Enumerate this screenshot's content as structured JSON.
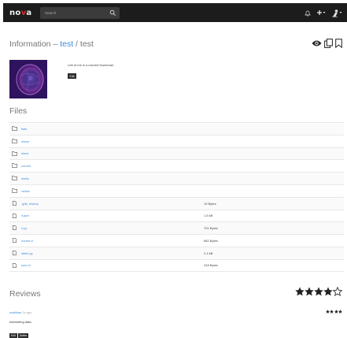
{
  "navbar": {
    "brand_prefix": "no",
    "brand_v": "v",
    "brand_suffix": "a",
    "search_placeholder": "Search",
    "icons": [
      "search-icon",
      "bell-icon",
      "plus-icon",
      "user-icon"
    ],
    "colors": {
      "bg": "#1c1c1c",
      "brand_accent": "#e02a2a"
    }
  },
  "header": {
    "prefix": "Information – ",
    "collection": "test",
    "separator": " / ",
    "name": "test",
    "icons": [
      "eye-icon",
      "copy-icon",
      "bookmark-icon"
    ]
  },
  "description": {
    "text": "Left of me is a colored thumbnail.",
    "edit_label": "Edit"
  },
  "files": {
    "title": "Files",
    "items": [
      {
        "type": "folder",
        "name": "flats",
        "size": ""
      },
      {
        "type": "folder",
        "name": "slices",
        "size": ""
      },
      {
        "type": "folder",
        "name": "sinos",
        "size": ""
      },
      {
        "type": "folder",
        "name": "correct",
        "size": ""
      },
      {
        "type": "folder",
        "name": "darks",
        "size": ""
      },
      {
        "type": "folder",
        "name": "radios",
        "size": ""
      },
      {
        "type": "file",
        "name": ".gdb_history",
        "size": "10 Bytes"
      },
      {
        "type": "file",
        "name": "ir.json",
        "size": "1.5 kB"
      },
      {
        "type": "file",
        "name": "ir.py",
        "size": "701 Bytes"
      },
      {
        "type": "file",
        "name": "norms.cl",
        "size": "682 Bytes"
      },
      {
        "type": "file",
        "name": "stitch.py",
        "size": "2.4 kB"
      },
      {
        "type": "file",
        "name": "sum.cl",
        "size": "318 Bytes"
      }
    ]
  },
  "reviews": {
    "title": "Reviews",
    "overall_rating": 4,
    "max_rating": 5,
    "items": [
      {
        "author": "matthias",
        "ago": "0s ago",
        "rating": 4,
        "text": "Interesting data",
        "edit_label": "Edit",
        "delete_label": "Delete"
      }
    ]
  }
}
